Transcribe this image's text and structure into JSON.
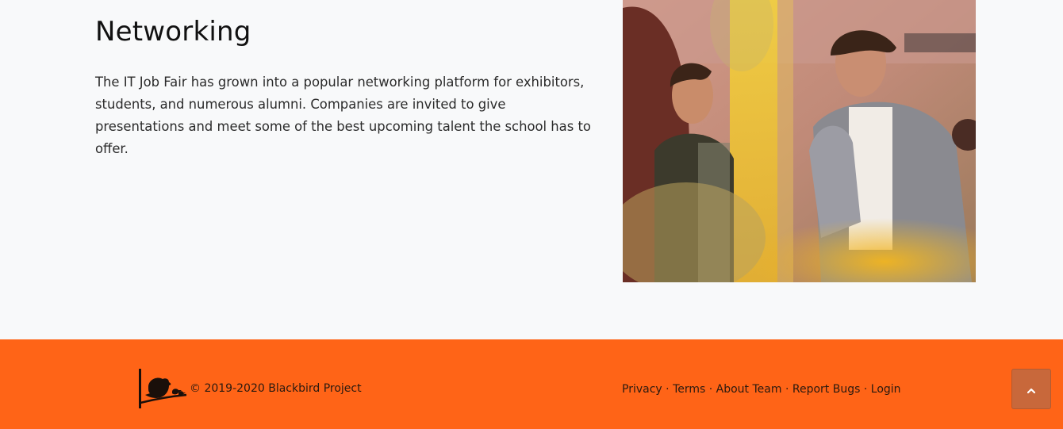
{
  "feature": {
    "heading": "Networking",
    "description": "The IT Job Fair has grown into a popular networking platform for exhibitors, students, and numerous alumni. Companies are invited to give presentations and meet some of the best upcoming talent the school has to offer."
  },
  "footer": {
    "copyright": "© 2019-2020 Blackbird Project",
    "links": [
      {
        "label": "Privacy"
      },
      {
        "label": "Terms"
      },
      {
        "label": "About Team"
      },
      {
        "label": "Report Bugs"
      },
      {
        "label": "Login"
      }
    ],
    "separator": "·"
  },
  "colors": {
    "footer_bg": "#ff6417",
    "page_bg": "#f8f9fa",
    "scroll_top_bg": "#c8683b"
  },
  "icons": {
    "logo": "blackbird-logo-icon",
    "scroll_top": "chevron-up-icon"
  }
}
